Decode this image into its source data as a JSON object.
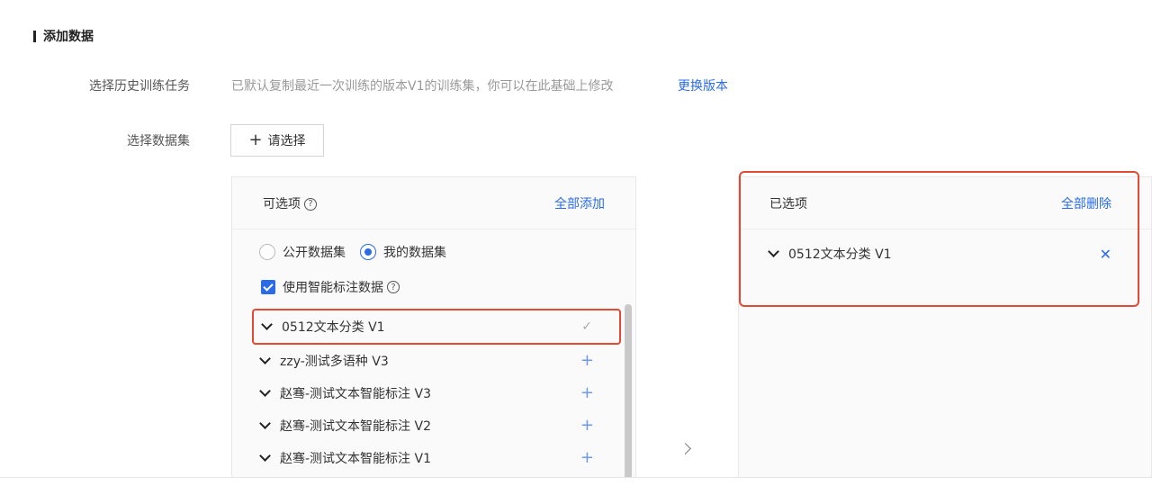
{
  "section": {
    "title": "添加数据"
  },
  "history": {
    "label": "选择历史训练任务",
    "hint": "已默认复制最近一次训练的版本V1的训练集，你可以在此基础上修改",
    "switch_link": "更换版本"
  },
  "dataset": {
    "label": "选择数据集",
    "select_button": "请选择"
  },
  "available": {
    "title": "可选项",
    "add_all": "全部添加",
    "radio_public": "公开数据集",
    "radio_mine": "我的数据集",
    "checkbox_label": "使用智能标注数据",
    "items": [
      {
        "label": "0512文本分类 V1",
        "state": "selected"
      },
      {
        "label": "zzy-测试多语种 V3",
        "state": "add"
      },
      {
        "label": "赵骞-测试文本智能标注 V3",
        "state": "add"
      },
      {
        "label": "赵骞-测试文本智能标注 V2",
        "state": "add"
      },
      {
        "label": "赵骞-测试文本智能标注 V1",
        "state": "add"
      }
    ]
  },
  "selected": {
    "title": "已选项",
    "delete_all": "全部删除",
    "items": [
      {
        "label": "0512文本分类 V1"
      }
    ]
  },
  "colors": {
    "accent": "#2a6ce8",
    "highlight": "#e34a34"
  }
}
